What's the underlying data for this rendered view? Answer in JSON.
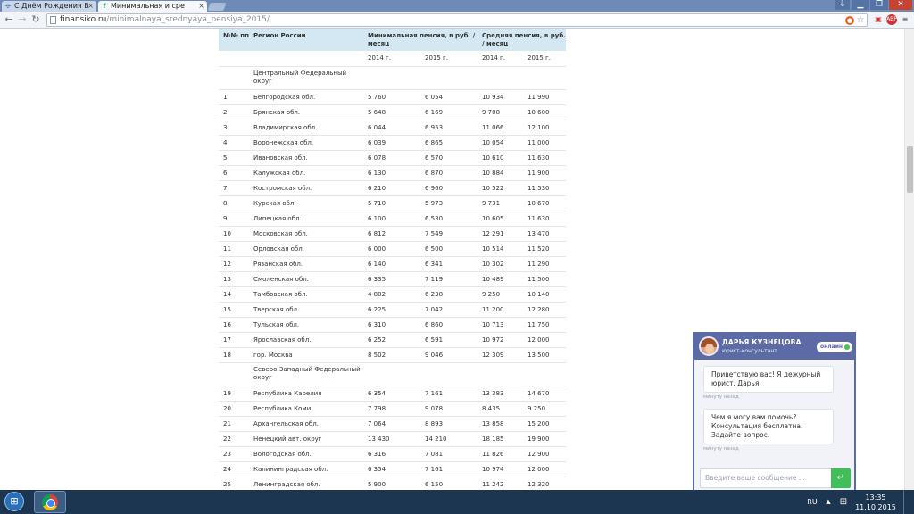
{
  "browser": {
    "tabs": [
      {
        "label": "С Днём Рождения В",
        "favicon": "puzzle-icon",
        "active": false
      },
      {
        "label": "Минимальная и сре",
        "favicon": "f-icon",
        "active": true
      }
    ],
    "url_host": "finansiko.ru",
    "url_path": "/minimalnaya_srednyaya_pensiya_2015/",
    "window_buttons": {
      "minimize": "▁",
      "maximize": "❐",
      "close": "✕"
    }
  },
  "table": {
    "headers": {
      "num": "№№ пп",
      "region": "Регион России",
      "min": "Минимальная пенсия, в руб. / месяц",
      "avg": "Средняя пенсия, в руб. / месяц"
    },
    "years": [
      "2014 г.",
      "2015 г.",
      "2014 г.",
      "2015 г."
    ],
    "district_central": "Центральный Федеральный округ",
    "district_nw": "Северо-Западный Федеральный округ",
    "rows_central": [
      [
        "1",
        "Белгородская обл.",
        "5 760",
        "6 054",
        "10 934",
        "11 990"
      ],
      [
        "2",
        "Брянская обл.",
        "5 648",
        "6 169",
        "9 708",
        "10 600"
      ],
      [
        "3",
        "Владимирская обл.",
        "6 044",
        "6 953",
        "11 066",
        "12 100"
      ],
      [
        "4",
        "Воронежская обл.",
        "6 039",
        "6 865",
        "10 054",
        "11 000"
      ],
      [
        "5",
        "Ивановская обл.",
        "6 078",
        "6 570",
        "10 610",
        "11 630"
      ],
      [
        "6",
        "Калужская обл.",
        "6 130",
        "6 870",
        "10 884",
        "11 900"
      ],
      [
        "7",
        "Костромская обл.",
        "6 210",
        "6 960",
        "10 522",
        "11 530"
      ],
      [
        "8",
        "Курская обл.",
        "5 710",
        "5 973",
        "9 731",
        "10 670"
      ],
      [
        "9",
        "Липецкая обл.",
        "6 100",
        "6 530",
        "10 605",
        "11 630"
      ],
      [
        "10",
        "Московская обл.",
        "6 812",
        "7 549",
        "12 291",
        "13 470"
      ],
      [
        "11",
        "Орловская обл.",
        "6 000",
        "6 500",
        "10 514",
        "11 520"
      ],
      [
        "12",
        "Рязанская обл.",
        "6 140",
        "6 341",
        "10 302",
        "11 290"
      ],
      [
        "13",
        "Смоленская обл.",
        "6 335",
        "7 119",
        "10 489",
        "11 500"
      ],
      [
        "14",
        "Тамбовская обл.",
        "4 802",
        "6 238",
        "9 250",
        "10 140"
      ],
      [
        "15",
        "Тверская обл.",
        "6 225",
        "7 042",
        "11 200",
        "12 280"
      ],
      [
        "16",
        "Тульская обл.",
        "6 310",
        "6 860",
        "10 713",
        "11 750"
      ],
      [
        "17",
        "Ярославская обл.",
        "6 252",
        "6 591",
        "10 972",
        "12 000"
      ],
      [
        "18",
        "гор. Москва",
        "8 502",
        "9 046",
        "12 309",
        "13 500"
      ]
    ],
    "rows_nw": [
      [
        "19",
        "Республика Карелия",
        "6 354",
        "7 161",
        "13 383",
        "14 670"
      ],
      [
        "20",
        "Республика Коми",
        "7 798",
        "9 078",
        "8 435",
        "9 250"
      ],
      [
        "21",
        "Архангельская обл.",
        "7 064",
        "8 893",
        "13 858",
        "15 200"
      ],
      [
        "22",
        "Ненецкий авт. округ",
        "13 430",
        "14 210",
        "18 185",
        "19 900"
      ],
      [
        "23",
        "Вологодская обл.",
        "6 316",
        "7 081",
        "11 826",
        "12 900"
      ],
      [
        "24",
        "Калининградская обл.",
        "6 354",
        "7 161",
        "10 974",
        "12 000"
      ],
      [
        "25",
        "Ленинградская обл.",
        "5 900",
        "6 150",
        "11 242",
        "12 320"
      ]
    ]
  },
  "chat": {
    "agent_name": "ДАРЬЯ КУЗНЕЦОВА",
    "agent_role": "юрист-консультант",
    "status": "онлайн",
    "messages": [
      {
        "text": "Приветствую вас! Я дежурный юрист. Дарья.",
        "time": "минуту назад"
      },
      {
        "text": "Чем я могу вам помочь? Консультация бесплатна. Задайте вопрос.",
        "time": "минуту назад"
      }
    ],
    "input_placeholder": "Введите ваше сообщение ...",
    "send_glyph": "↵"
  },
  "taskbar": {
    "language": "RU",
    "time": "13:35",
    "date": "11.10.2015"
  }
}
